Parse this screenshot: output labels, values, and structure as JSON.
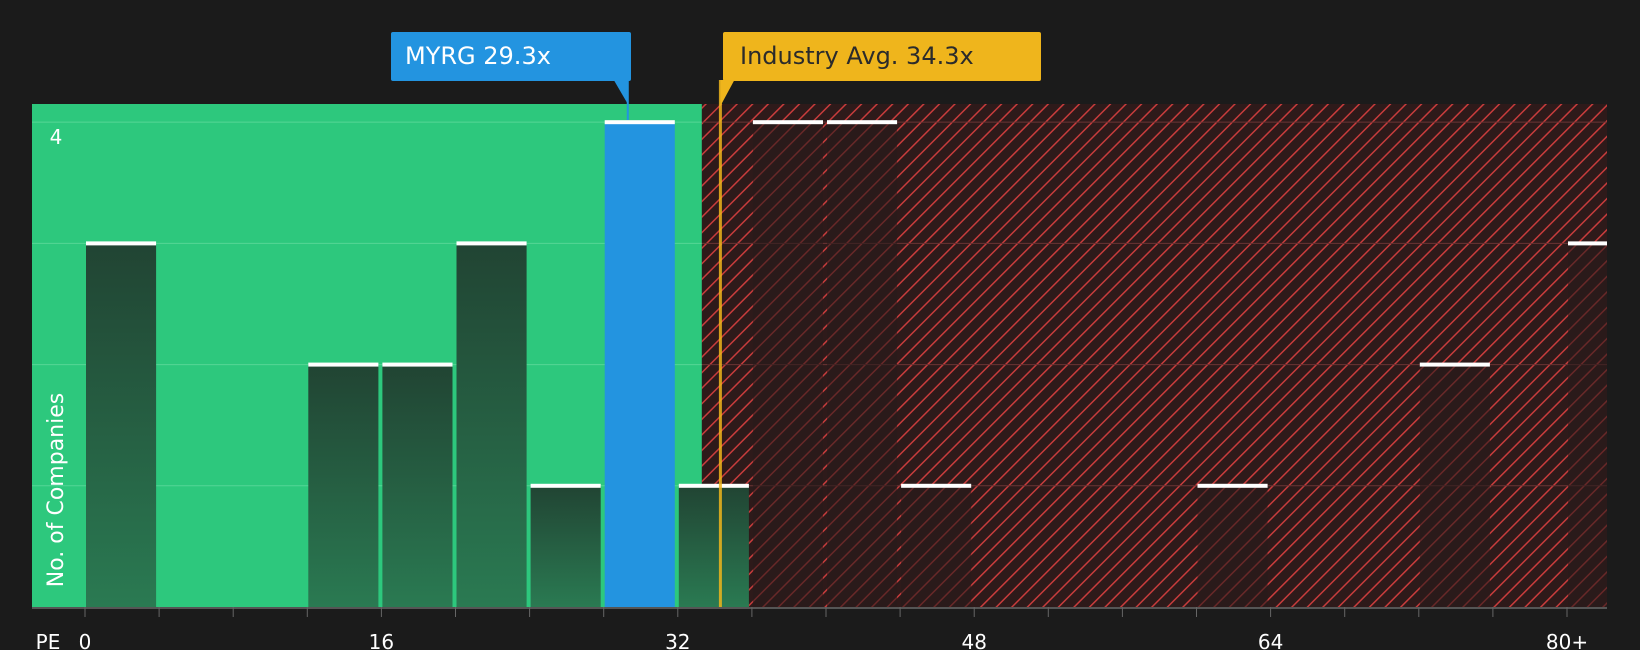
{
  "chart_data": {
    "type": "bar",
    "ylabel": "No. of Companies",
    "xlabel_prefix": "PE",
    "x_tick_labels": [
      "0",
      "16",
      "32",
      "48",
      "64",
      "80+"
    ],
    "x_tick_values": [
      0,
      16,
      32,
      48,
      64,
      80
    ],
    "y_tick_labels": [
      "4"
    ],
    "y_tick_values": [
      4
    ],
    "ylim": [
      0,
      4.15
    ],
    "bin_width": 4,
    "bins": [
      {
        "x0": 0,
        "count": 3
      },
      {
        "x0": 4,
        "count": 0
      },
      {
        "x0": 8,
        "count": 0
      },
      {
        "x0": 12,
        "count": 2
      },
      {
        "x0": 16,
        "count": 2
      },
      {
        "x0": 20,
        "count": 3
      },
      {
        "x0": 24,
        "count": 1
      },
      {
        "x0": 28,
        "count": 4,
        "highlight": true
      },
      {
        "x0": 32,
        "count": 1
      },
      {
        "x0": 36,
        "count": 4
      },
      {
        "x0": 40,
        "count": 4
      },
      {
        "x0": 44,
        "count": 1
      },
      {
        "x0": 48,
        "count": 0
      },
      {
        "x0": 52,
        "count": 0
      },
      {
        "x0": 56,
        "count": 0
      },
      {
        "x0": 60,
        "count": 1
      },
      {
        "x0": 64,
        "count": 0
      },
      {
        "x0": 68,
        "count": 0
      },
      {
        "x0": 72,
        "count": 2
      },
      {
        "x0": 76,
        "count": 0
      },
      {
        "x0": 80,
        "count": 3
      }
    ],
    "company": {
      "label": "MYRG 29.3x",
      "value": 29.3
    },
    "industry_avg": {
      "label": "Industry Avg. 34.3x",
      "value": 34.3
    },
    "undervalued_to": 33.3,
    "colors": {
      "background": "#1b1b1b",
      "good_zone": "#2dc87d",
      "bad_zone": "#3a1c1c",
      "bad_hatch": "#c83c3c",
      "company": "#2394e0",
      "industry": "#efb51c",
      "bar_dark": "#224a36",
      "bar_light": "#2a7550"
    }
  }
}
